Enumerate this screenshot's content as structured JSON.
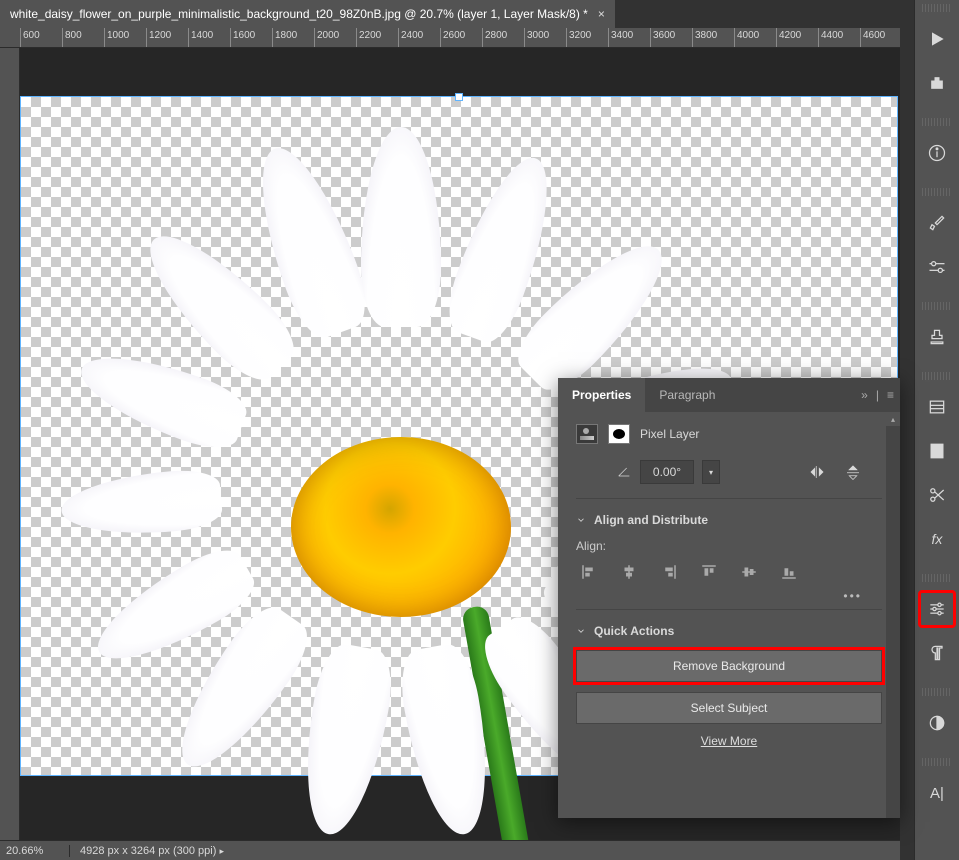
{
  "document_tab": {
    "title": "white_daisy_flower_on_purple_minimalistic_background_t20_98Z0nB.jpg @ 20.7% (layer 1, Layer Mask/8) *"
  },
  "ruler": {
    "ticks": [
      "600",
      "800",
      "1000",
      "1200",
      "1400",
      "1600",
      "1800",
      "2000",
      "2200",
      "2400",
      "2600",
      "2800",
      "3000",
      "3200",
      "3400",
      "3600",
      "3800",
      "4000",
      "4200",
      "4400",
      "4600"
    ]
  },
  "panel": {
    "tabs": {
      "properties": "Properties",
      "paragraph": "Paragraph"
    },
    "active_tab": "properties",
    "layer_type": "Pixel Layer",
    "rotation_value": "0.00°",
    "sections": {
      "align_title": "Align and Distribute",
      "align_label": "Align:",
      "quick_title": "Quick Actions"
    },
    "buttons": {
      "remove_bg": "Remove Background",
      "select_subject": "Select Subject",
      "view_more": "View More"
    }
  },
  "status": {
    "zoom": "20.66%",
    "info": "4928 px x 3264 px (300 ppi)"
  },
  "icons": {
    "menu_collapse": "»"
  }
}
